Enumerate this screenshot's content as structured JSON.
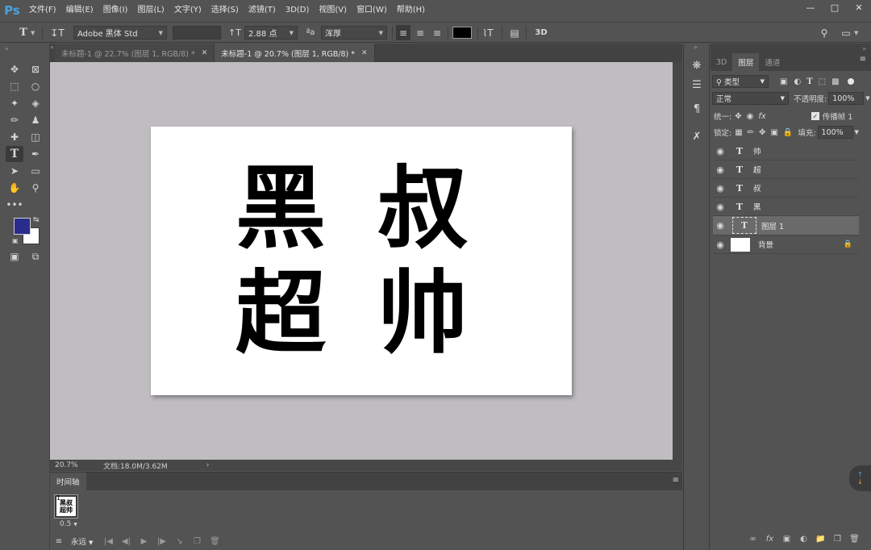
{
  "app": {
    "logo": "Ps",
    "menu": [
      "文件(F)",
      "编辑(E)",
      "图像(I)",
      "图层(L)",
      "文字(Y)",
      "选择(S)",
      "滤镜(T)",
      "3D(D)",
      "视图(V)",
      "窗口(W)",
      "帮助(H)"
    ],
    "window_controls": [
      "minimize-icon",
      "maximize-icon",
      "close-icon"
    ]
  },
  "options_bar": {
    "tool_icon": "T",
    "font_family": "Adobe 黑体 Std",
    "font_size": "2.88 点",
    "aa_label": "ªa",
    "antialias": "浑厚",
    "color_swatch": "#000000",
    "three_d": "3D"
  },
  "documents": {
    "tabs": [
      {
        "label": "未标题-1 @ 22.7% (图层 1, RGB/8) *",
        "active": false
      },
      {
        "label": "未标题-1 @ 20.7% (图层 1, RGB/8) *",
        "active": true
      }
    ],
    "canvas_text": [
      "黑",
      "叔",
      "超",
      "帅"
    ],
    "status": {
      "zoom": "20.7%",
      "doc_info": "文档:18.0M/3.62M"
    }
  },
  "timeline": {
    "tab_label": "时间轴",
    "frame": {
      "number": "1",
      "thumb_text": "黑叔\n超帅",
      "delay": "0.5"
    },
    "loop": "永远"
  },
  "tool_colors": {
    "foreground": "#2a2c8c",
    "background": "#ffffff"
  },
  "layers_panel": {
    "tabs": [
      {
        "label": "3D",
        "active": false
      },
      {
        "label": "图层",
        "active": true
      },
      {
        "label": "通道",
        "active": false
      }
    ],
    "filter_kind": "类型",
    "blend_mode": "正常",
    "opacity_label": "不透明度:",
    "opacity_value": "100%",
    "unify_label": "统一:",
    "propagate_label": "传播帧 1",
    "lock_label": "锁定:",
    "fill_label": "填充:",
    "fill_value": "100%",
    "layers": [
      {
        "name": "帅",
        "kind": "text"
      },
      {
        "name": "超",
        "kind": "text"
      },
      {
        "name": "叔",
        "kind": "text"
      },
      {
        "name": "黑",
        "kind": "text"
      },
      {
        "name": "图层 1",
        "kind": "text-selected"
      },
      {
        "name": "背景",
        "kind": "background"
      }
    ]
  }
}
